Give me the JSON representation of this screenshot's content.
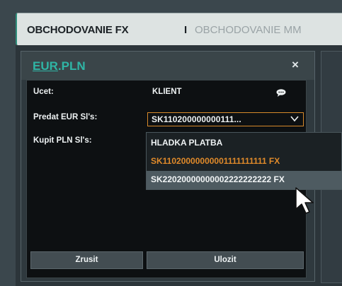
{
  "tabs": {
    "active": "OBCHODOVANIE FX",
    "separator": "I",
    "inactive": "OBCHODOVANIE MM"
  },
  "widget": {
    "pair_base": "EUR",
    "pair_rest": ".PLN",
    "close_symbol": "×"
  },
  "form": {
    "account_label": "Ucet:",
    "account_value": "KLIENT",
    "sell_label": "Predat EUR Sl's:",
    "sell_selected": "SK110200000000111...",
    "buy_label": "Kupit PLN Sl's:"
  },
  "dropdown": {
    "options": [
      "HLADKA PLATBA",
      "SK11020000000001111111111 FX",
      "SK22020000000002222222222 FX"
    ]
  },
  "buttons": {
    "cancel": "Zrusit",
    "save": "Ulozit"
  },
  "colors": {
    "accent_teal": "#2fb5a5",
    "highlight_orange": "#e08a2a"
  }
}
